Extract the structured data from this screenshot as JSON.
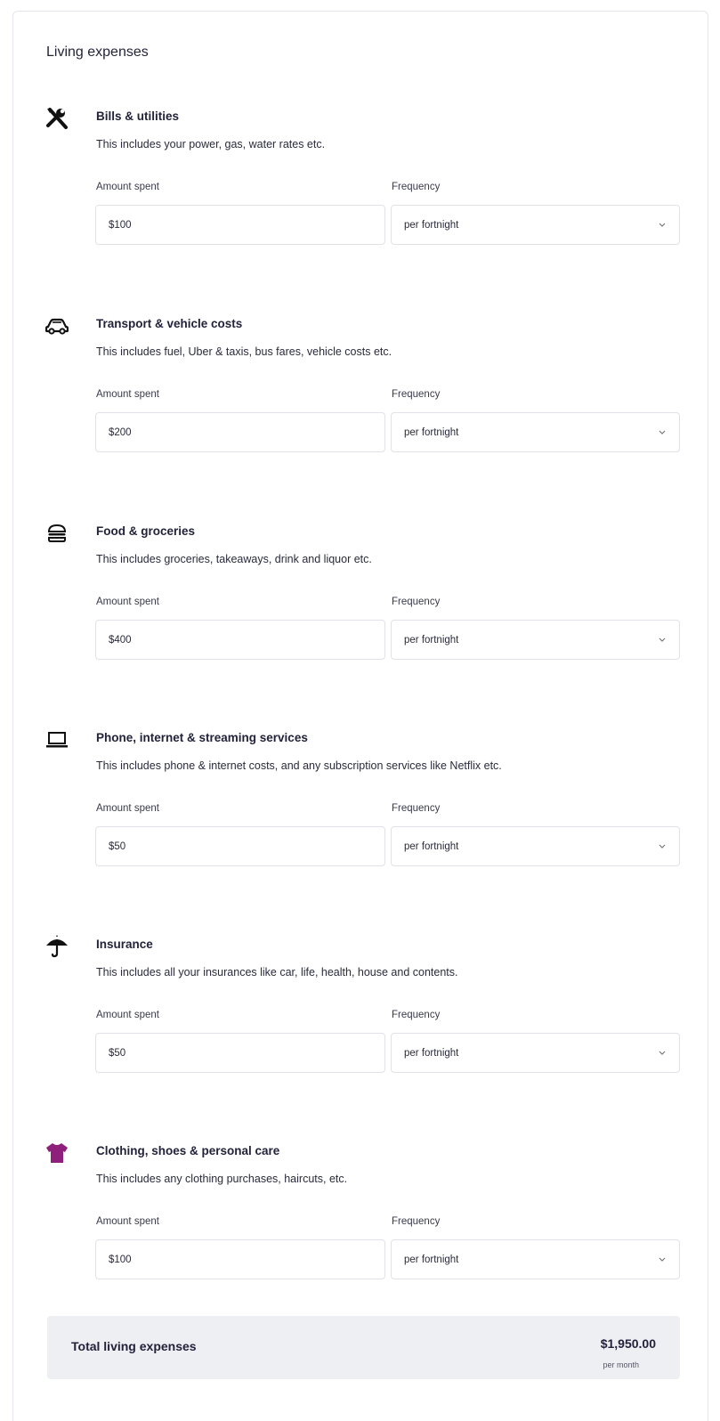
{
  "section": {
    "title": "Living expenses"
  },
  "labels": {
    "amount": "Amount spent",
    "frequency": "Frequency"
  },
  "categories": [
    {
      "icon": "tools-icon",
      "name": "Bills & utilities",
      "description": "This includes your power, gas, water rates etc.",
      "amount": "$100",
      "frequency": "per fortnight"
    },
    {
      "icon": "car-icon",
      "name": "Transport & vehicle costs",
      "description": "This includes fuel, Uber & taxis, bus fares, vehicle costs etc.",
      "amount": "$200",
      "frequency": "per fortnight"
    },
    {
      "icon": "burger-icon",
      "name": "Food & groceries",
      "description": "This includes groceries, takeaways, drink and liquor etc.",
      "amount": "$400",
      "frequency": "per fortnight"
    },
    {
      "icon": "laptop-icon",
      "name": "Phone, internet & streaming services",
      "description": "This includes phone & internet costs, and any subscription services like Netflix etc.",
      "amount": "$50",
      "frequency": "per fortnight"
    },
    {
      "icon": "umbrella-icon",
      "name": "Insurance",
      "description": "This includes all your insurances like car, life, health, house and contents.",
      "amount": "$50",
      "frequency": "per fortnight"
    },
    {
      "icon": "tshirt-icon",
      "name": "Clothing, shoes & personal care",
      "description": "This includes any clothing purchases, haircuts, etc.",
      "amount": "$100",
      "frequency": "per fortnight"
    }
  ],
  "total": {
    "label": "Total living expenses",
    "value": "$1,950.00",
    "period": "per month"
  },
  "colors": {
    "tshirt_icon": "#8e1f7a",
    "total_background": "#eeeff3",
    "input_border": "#e1e2e8"
  }
}
